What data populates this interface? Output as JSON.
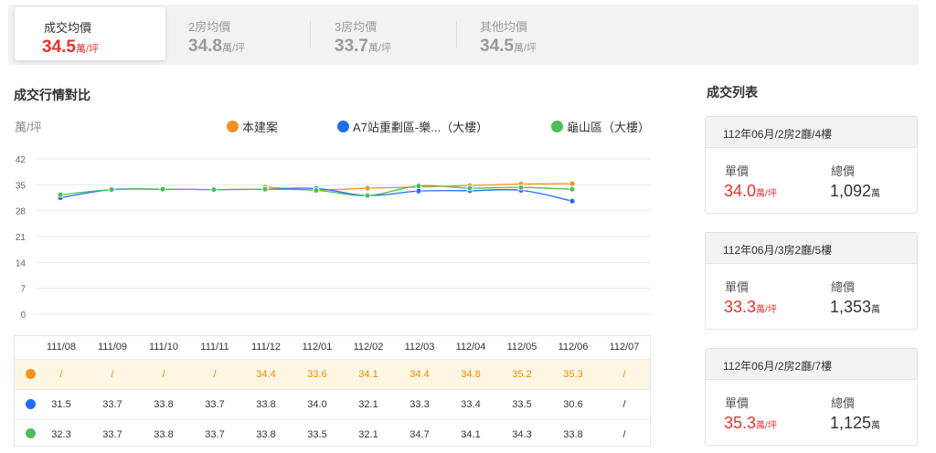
{
  "tabs": [
    {
      "label": "成交均價",
      "value": "34.5",
      "unit": "萬/坪"
    },
    {
      "label": "2房均價",
      "value": "34.8",
      "unit": "萬/坪"
    },
    {
      "label": "3房均價",
      "value": "33.7",
      "unit": "萬/坪"
    },
    {
      "label": "其他均價",
      "value": "34.5",
      "unit": "萬/坪"
    }
  ],
  "chart_section": {
    "title": "成交行情對比",
    "y_unit": "萬/坪"
  },
  "list_section": {
    "title": "成交列表",
    "price_label": "單價",
    "total_label": "總價",
    "price_unit": "萬/坪",
    "total_unit": "萬",
    "items": [
      {
        "header": "112年06月/2房2廳/4樓",
        "price": "34.0",
        "total": "1,092"
      },
      {
        "header": "112年06月/3房2廳/5樓",
        "price": "33.3",
        "total": "1,353"
      },
      {
        "header": "112年06月/2房2廳/7樓",
        "price": "35.3",
        "total": "1,125"
      }
    ]
  },
  "chart_data": {
    "type": "line",
    "x": [
      "111/08",
      "111/09",
      "111/10",
      "111/11",
      "111/12",
      "112/01",
      "112/02",
      "112/03",
      "112/04",
      "112/05",
      "112/06",
      "112/07"
    ],
    "ylabel": "萬/坪",
    "ylim": [
      0,
      42
    ],
    "yticks": [
      0,
      7,
      14,
      21,
      28,
      35,
      42
    ],
    "grid": true,
    "legend_position": "top-right",
    "series": [
      {
        "name": "本建案",
        "color": "#f39221",
        "values": [
          null,
          null,
          null,
          null,
          34.4,
          33.6,
          34.1,
          34.4,
          34.8,
          35.2,
          35.3,
          null
        ],
        "display": [
          "/",
          "/",
          "/",
          "/",
          "34.4",
          "33.6",
          "34.1",
          "34.4",
          "34.8",
          "35.2",
          "35.3",
          "/"
        ]
      },
      {
        "name": "A7站重劃區-樂...（大樓）",
        "color": "#1f6ef0",
        "values": [
          31.5,
          33.7,
          33.8,
          33.7,
          33.8,
          34.0,
          32.1,
          33.3,
          33.4,
          33.5,
          30.6,
          null
        ],
        "display": [
          "31.5",
          "33.7",
          "33.8",
          "33.7",
          "33.8",
          "34.0",
          "32.1",
          "33.3",
          "33.4",
          "33.5",
          "30.6",
          "/"
        ]
      },
      {
        "name": "龜山區（大樓）",
        "color": "#4cbf5a",
        "values": [
          32.3,
          33.7,
          33.8,
          33.7,
          33.8,
          33.5,
          32.1,
          34.7,
          34.1,
          34.3,
          33.8,
          null
        ],
        "display": [
          "32.3",
          "33.7",
          "33.8",
          "33.7",
          "33.8",
          "33.5",
          "32.1",
          "34.7",
          "34.1",
          "34.3",
          "33.8",
          "/"
        ]
      }
    ]
  }
}
